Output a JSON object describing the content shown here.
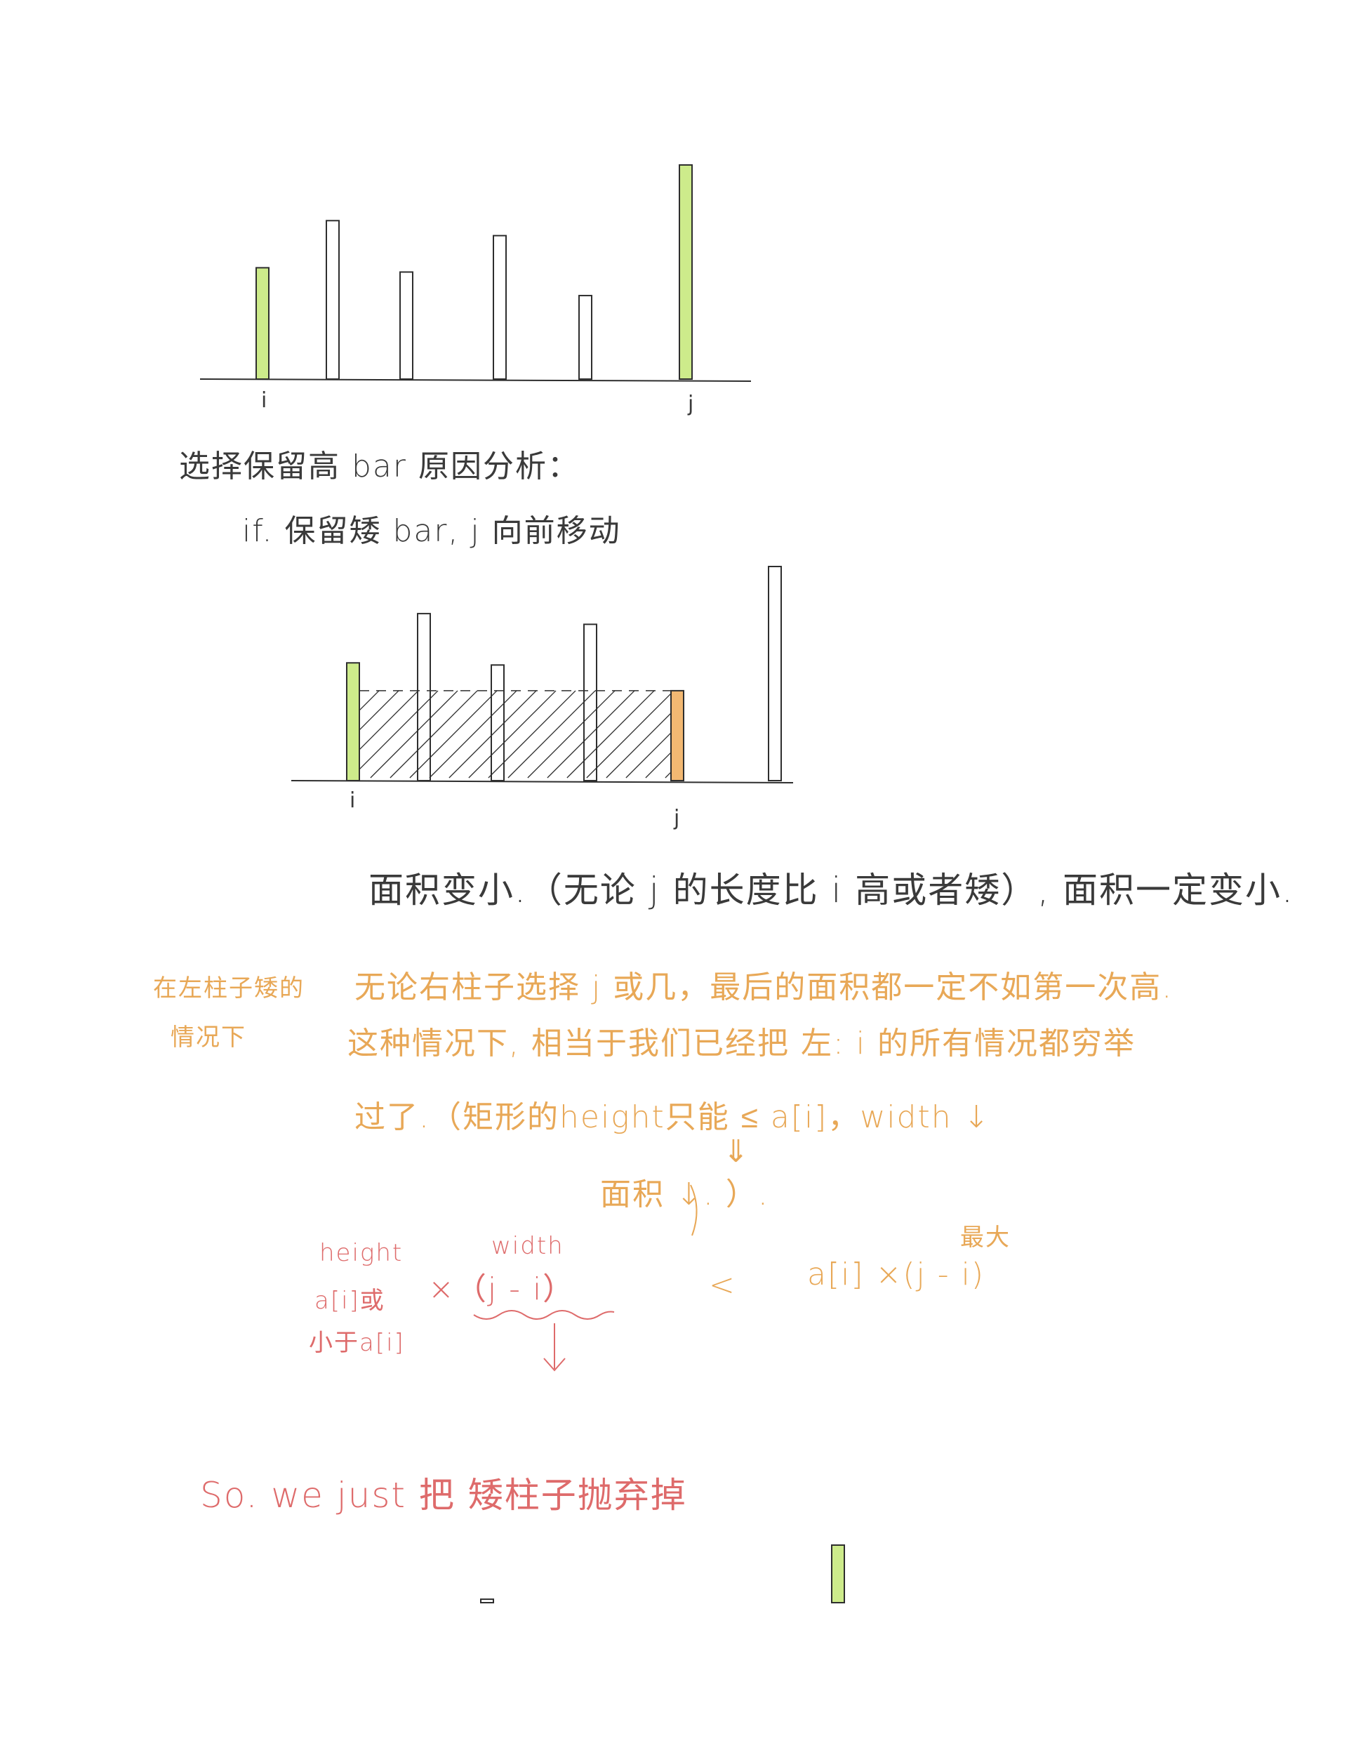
{
  "colors": {
    "ink": "#2e2e2e",
    "green": "#cdeb8b",
    "orange_bar": "#f2b872",
    "orange_text": "#e8a857",
    "red_text": "#de6b6b"
  },
  "figure1": {
    "bars": [
      {
        "index": 0,
        "height": 0.52,
        "fill": "green"
      },
      {
        "index": 1,
        "height": 0.74,
        "fill": "none"
      },
      {
        "index": 2,
        "height": 0.5,
        "fill": "none"
      },
      {
        "index": 3,
        "height": 0.67,
        "fill": "none"
      },
      {
        "index": 4,
        "height": 0.39,
        "fill": "none"
      },
      {
        "index": 5,
        "height": 1.0,
        "fill": "green"
      }
    ],
    "label_i": "i",
    "label_j": "j"
  },
  "text1": "选择保留高 bar 原因分析：",
  "text2": "if. 保留矮 bar, j 向前移动",
  "figure2": {
    "bars": [
      {
        "index": 0,
        "height": 0.55,
        "fill": "green"
      },
      {
        "index": 1,
        "height": 0.78,
        "fill": "none"
      },
      {
        "index": 2,
        "height": 0.54,
        "fill": "none"
      },
      {
        "index": 3,
        "height": 0.73,
        "fill": "none"
      },
      {
        "index": 4,
        "height": 0.42,
        "fill": "orange"
      },
      {
        "index": 5,
        "height": 1.0,
        "fill": "none"
      }
    ],
    "label_i": "i",
    "label_j": "j"
  },
  "text3": "面积变小.（无论 j 的长度比 i 高或者矮）, 面积一定变小.",
  "side_note_line1": "在左柱子矮的",
  "side_note_line2": "情况下",
  "text4": "无论右柱子选择 j 或几，最后的面积都一定不如第一次高.",
  "text5": "这种情况下, 相当于我们已经把 左: i 的所有情况都穷举",
  "text6": "过了.（矩形的height只能 ≤ a[i]，width ↓",
  "text7_arrow": "⇓",
  "text8": "面积 ↓.     ）.",
  "formula": {
    "height_label": "height",
    "width_label": "width",
    "left_line1": "a[i]或",
    "left_line2": "小于a[i]",
    "left_expr": "×（j - i）",
    "less_than": "<",
    "max_label": "最大",
    "right_expr": "a[i] ×(j - i)",
    "down_arrow": "↓"
  },
  "conclusion": "So. we just 把 矮柱子抛弃掉",
  "figure3": {
    "bars": [
      {
        "index": 0,
        "height": 0.06,
        "fill": "none"
      },
      {
        "index": 1,
        "height": 1.0,
        "fill": "green"
      }
    ]
  }
}
